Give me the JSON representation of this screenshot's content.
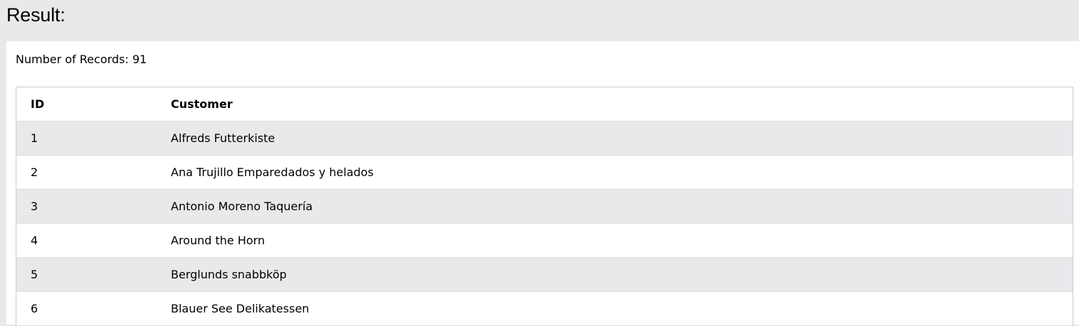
{
  "result": {
    "title": "Result:",
    "record_count_text": "Number of Records: 91"
  },
  "table": {
    "columns": [
      "ID",
      "Customer"
    ],
    "rows": [
      {
        "id": "1",
        "customer": "Alfreds Futterkiste"
      },
      {
        "id": "2",
        "customer": "Ana Trujillo Emparedados y helados"
      },
      {
        "id": "3",
        "customer": "Antonio Moreno Taquería"
      },
      {
        "id": "4",
        "customer": "Around the Horn"
      },
      {
        "id": "5",
        "customer": "Berglunds snabbköp"
      },
      {
        "id": "6",
        "customer": "Blauer See Delikatessen"
      }
    ]
  },
  "colors": {
    "header_bg": "#e7e9eb",
    "panel_bg": "#ffffff",
    "stripe_bg": "#e7e9eb",
    "border": "#cccccc"
  }
}
